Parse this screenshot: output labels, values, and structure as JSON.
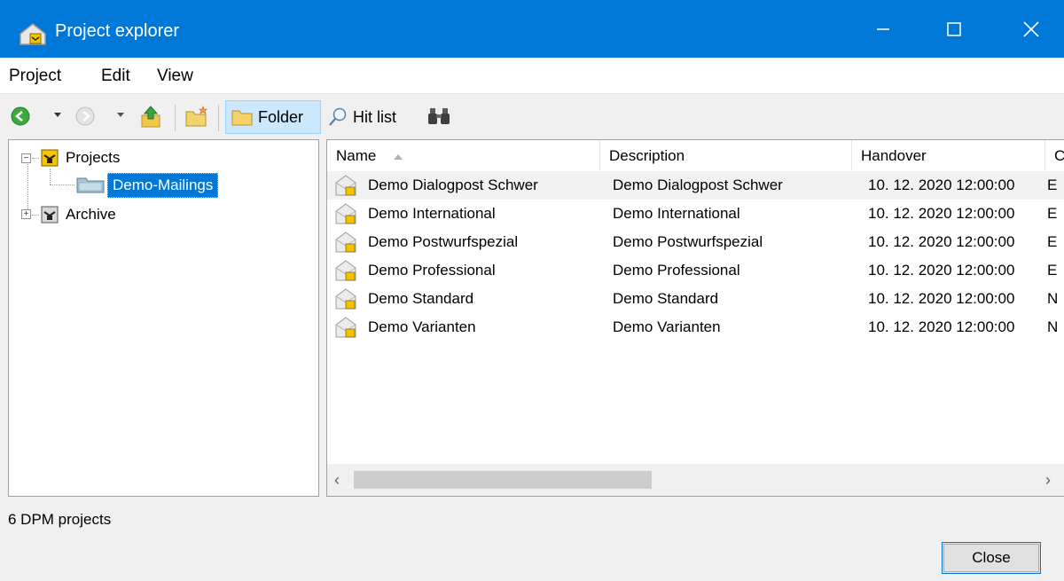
{
  "window": {
    "title": "Project explorer",
    "accent_color": "#0078d7",
    "controls": {
      "minimize_icon": "minimize-icon",
      "maximize_icon": "maximize-icon",
      "close_icon": "close-icon"
    }
  },
  "menu": {
    "items": [
      "Project",
      "Edit",
      "View"
    ]
  },
  "toolbar": {
    "back_icon": "back-arrow-icon",
    "forward_icon": "forward-arrow-icon",
    "up_icon": "up-folder-icon",
    "new_folder_icon": "new-folder-icon",
    "folder_label": "Folder",
    "hitlist_label": "Hit list",
    "find_icon": "binoculars-icon"
  },
  "tree": {
    "nodes": [
      {
        "label": "Projects",
        "expanded": true
      },
      {
        "label": "Demo-Mailings",
        "selected": true
      },
      {
        "label": "Archive",
        "expanded": false
      }
    ]
  },
  "list": {
    "columns": [
      "Name",
      "Description",
      "Handover",
      "C"
    ],
    "sort_column": "Name",
    "sort_direction": "ascending",
    "rows": [
      {
        "name": "Demo Dialogpost Schwer",
        "description": "Demo Dialogpost Schwer",
        "handover": "10. 12. 2020 12:00:00",
        "c": "E"
      },
      {
        "name": "Demo International",
        "description": "Demo International",
        "handover": "10. 12. 2020 12:00:00",
        "c": "E"
      },
      {
        "name": "Demo Postwurfspezial",
        "description": "Demo Postwurfspezial",
        "handover": "10. 12. 2020 12:00:00",
        "c": "E"
      },
      {
        "name": "Demo Professional",
        "description": "Demo Professional",
        "handover": "10. 12. 2020 12:00:00",
        "c": "E"
      },
      {
        "name": "Demo Standard",
        "description": "Demo Standard",
        "handover": "10. 12. 2020 12:00:00",
        "c": "N"
      },
      {
        "name": "Demo Varianten",
        "description": "Demo Varianten",
        "handover": "10. 12. 2020 12:00:00",
        "c": "N"
      }
    ]
  },
  "status": {
    "text": "6 DPM projects"
  },
  "buttons": {
    "close_label": "Close"
  }
}
